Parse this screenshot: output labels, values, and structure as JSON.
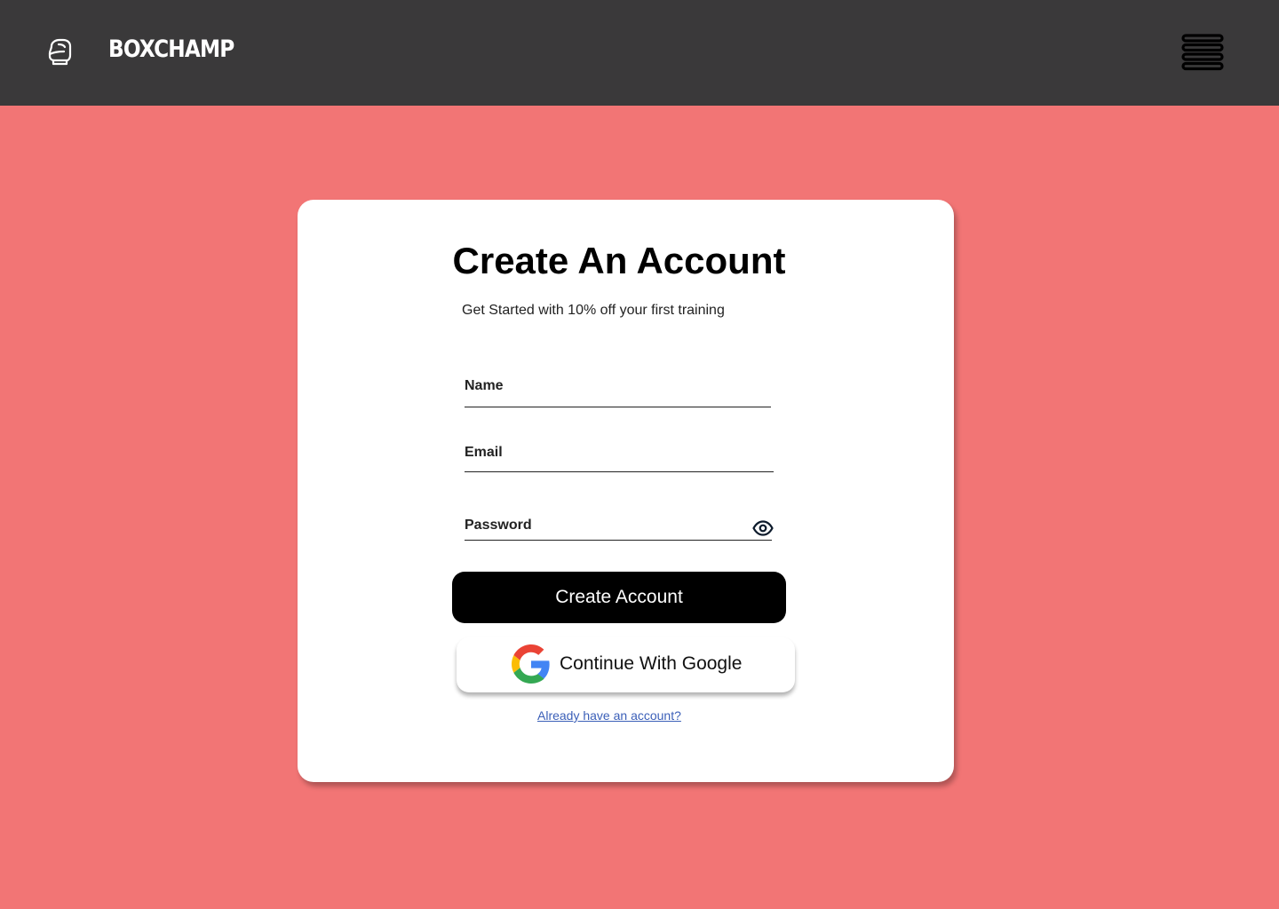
{
  "header": {
    "brand": "BOXCHAMP",
    "logo_icon": "boxing-glove-icon",
    "menu_icon": "hamburger-menu-icon"
  },
  "form": {
    "title": "Create An Account",
    "subtitle": "Get Started with 10% off your first training",
    "fields": {
      "name_label": "Name",
      "email_label": "Email",
      "password_label": "Password"
    },
    "password_toggle_icon": "eye-icon",
    "create_button": "Create Account",
    "google_button": "Continue With Google",
    "login_link": "Already have an account?"
  },
  "colors": {
    "background": "#f27575",
    "header": "#3a393a",
    "card": "#ffffff",
    "primary_button": "#000000",
    "link": "#3b5fb8"
  }
}
